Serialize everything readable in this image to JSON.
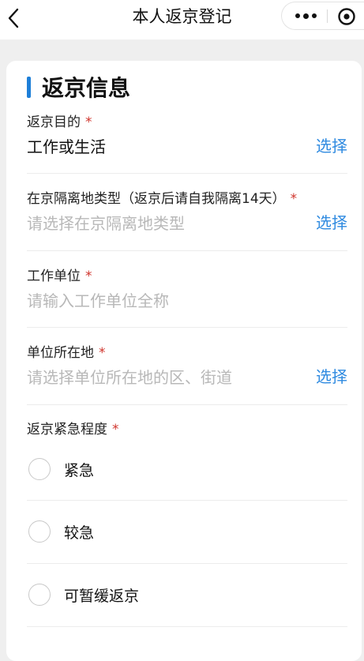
{
  "nav": {
    "title": "本人返京登记"
  },
  "section": {
    "title": "返京信息"
  },
  "fields": [
    {
      "label": "返京目的",
      "required_mark": "*",
      "value": "工作或生活",
      "placeholder": "",
      "action": "选择"
    },
    {
      "label": "在京隔离地类型（返京后请自我隔离14天）",
      "required_mark": "*",
      "value": "",
      "placeholder": "请选择在京隔离地类型",
      "action": "选择"
    },
    {
      "label": "工作单位",
      "required_mark": "*",
      "value": "",
      "placeholder": "请输入工作单位全称",
      "action": ""
    },
    {
      "label": "单位所在地",
      "required_mark": "*",
      "value": "",
      "placeholder": "请选择单位所在地的区、街道",
      "action": "选择"
    }
  ],
  "urgency": {
    "label": "返京紧急程度",
    "required_mark": "*",
    "options": [
      {
        "label": "紧急",
        "selected": false
      },
      {
        "label": "较急",
        "selected": false
      },
      {
        "label": "可暂缓返京",
        "selected": false
      }
    ]
  },
  "icons": {
    "back": "chevron-left-icon",
    "more": "more-dots-icon",
    "close": "target-circle-icon"
  },
  "colors": {
    "accent": "#2e8ae0",
    "section_bar": "#1e7fd8",
    "required": "#d0342c",
    "placeholder": "#b8b8b8",
    "background": "#efefef"
  }
}
